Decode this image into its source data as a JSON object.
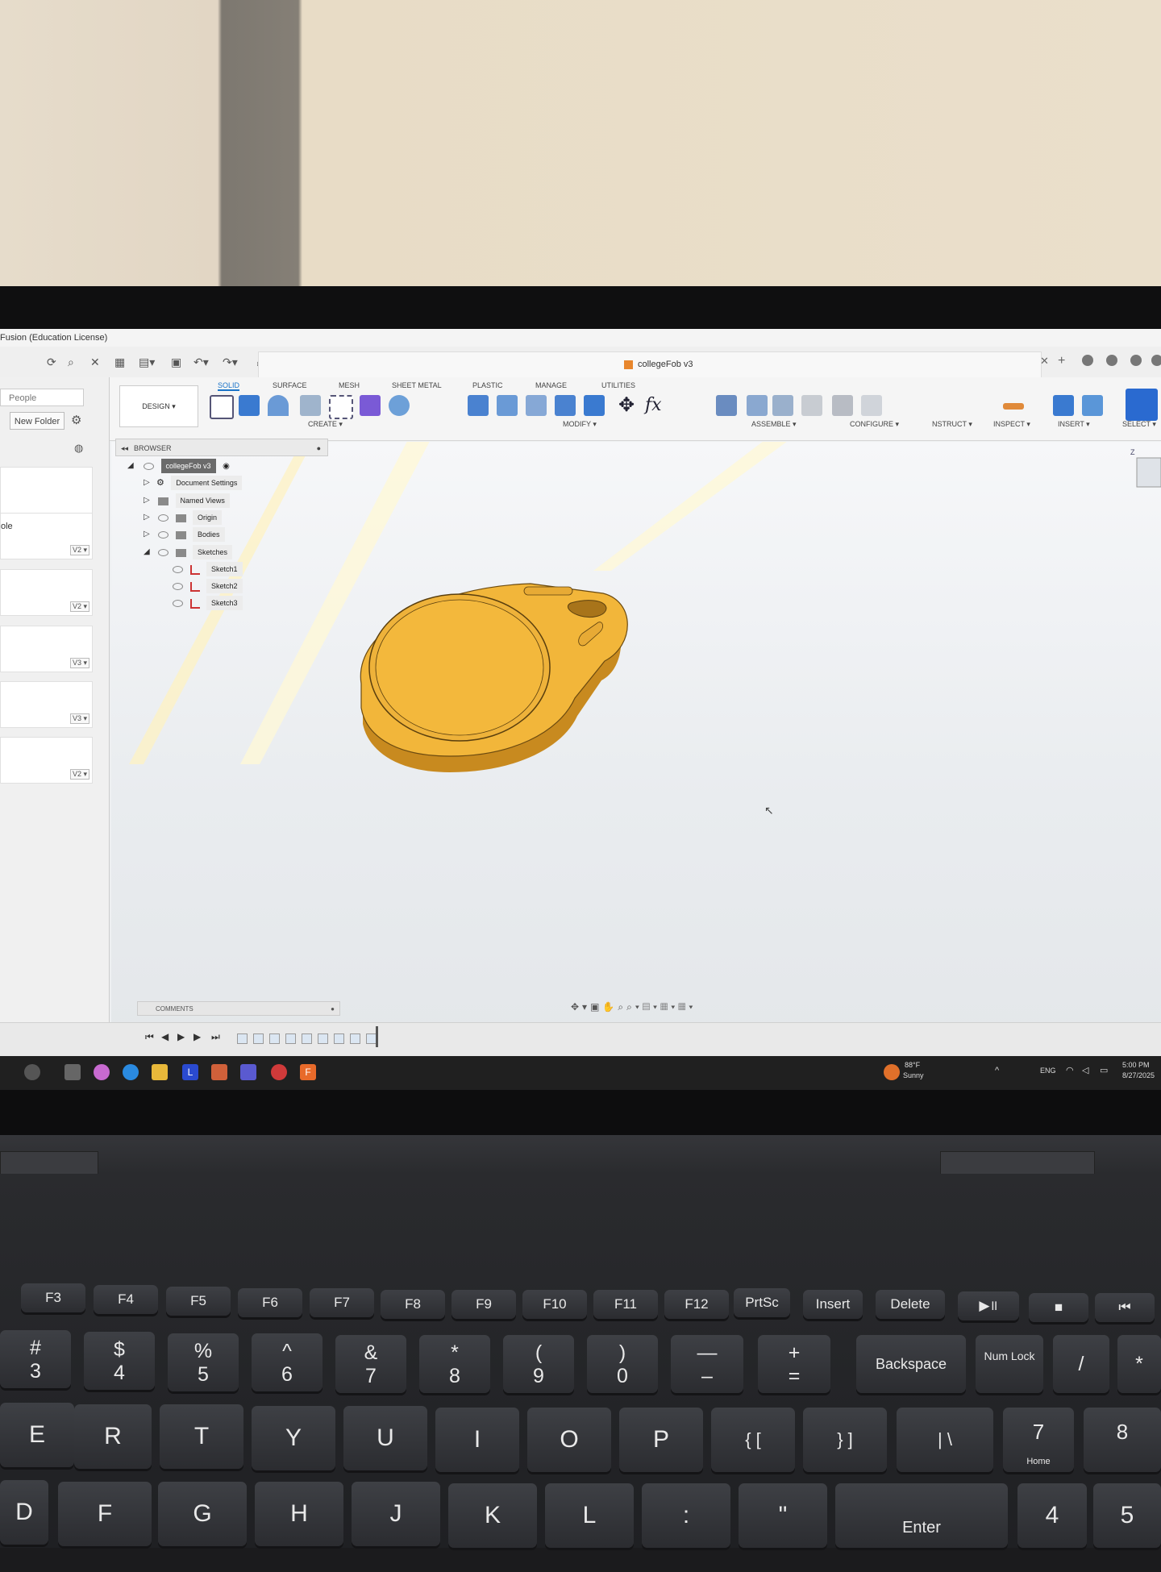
{
  "window": {
    "title": "Fusion (Education License)"
  },
  "document": {
    "tab_title": "collegeFob v3"
  },
  "data_panel": {
    "people_label": "People",
    "new_folder_label": "New Folder",
    "partial_label": "ole",
    "versions": [
      "V2 ▾",
      "V2 ▾",
      "V3 ▾",
      "V3 ▾",
      "V2 ▾"
    ]
  },
  "ribbon": {
    "workspace": "DESIGN ▾",
    "tabs": [
      "SOLID",
      "SURFACE",
      "MESH",
      "SHEET METAL",
      "PLASTIC",
      "MANAGE",
      "UTILITIES"
    ],
    "active_tab": "SOLID",
    "groups": [
      "CREATE ▾",
      "MODIFY ▾",
      "ASSEMBLE ▾",
      "CONFIGURE ▾",
      "NSTRUCT ▾",
      "INSPECT ▾",
      "INSERT ▾",
      "SELECT ▾"
    ]
  },
  "browser": {
    "header": "BROWSER",
    "root": "collegeFob v3",
    "items": [
      "Document Settings",
      "Named Views",
      "Origin",
      "Bodies",
      "Sketches"
    ],
    "sketches": [
      "Sketch1",
      "Sketch2",
      "Sketch3"
    ]
  },
  "comments": {
    "label": "COMMENTS"
  },
  "model": {
    "color": "#f2b63a"
  },
  "taskbar": {
    "weather_temp": "88°F",
    "weather_cond": "Sunny",
    "lang": "ENG",
    "time": "5:00 PM",
    "date": "8/27/2025"
  },
  "keyboard": {
    "fkeys": [
      "F3",
      "F4",
      "F5",
      "F6",
      "F7",
      "F8",
      "F9",
      "F10",
      "F11",
      "F12",
      "PrtSc",
      "Insert",
      "Delete"
    ],
    "number_row": [
      {
        "top": "#",
        "bot": "3"
      },
      {
        "top": "$",
        "bot": "4"
      },
      {
        "top": "%",
        "bot": "5"
      },
      {
        "top": "^",
        "bot": "6"
      },
      {
        "top": "&",
        "bot": "7"
      },
      {
        "top": "*",
        "bot": "8"
      },
      {
        "top": "(",
        "bot": "9"
      },
      {
        "top": ")",
        "bot": "0"
      },
      {
        "top": "—",
        "bot": "–"
      },
      {
        "top": "+",
        "bot": "="
      }
    ],
    "backspace": "Backspace",
    "numlock": "Num Lock",
    "letters_row1": [
      "E",
      "R",
      "T",
      "Y",
      "U",
      "I",
      "O",
      "P"
    ],
    "letters_row2": [
      "D",
      "F",
      "G",
      "H",
      "J",
      "K",
      "L"
    ],
    "enter": "Enter",
    "home": "Home"
  },
  "colors": {
    "accent": "#1a73c8",
    "model": "#f2b63a",
    "taskbar": "#202020"
  }
}
